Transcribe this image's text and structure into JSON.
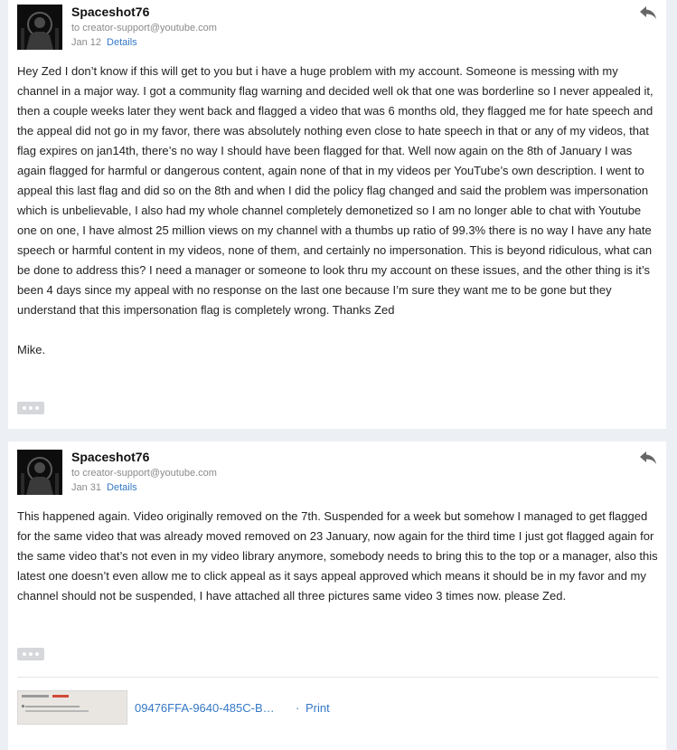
{
  "messages": [
    {
      "sender": "Spaceshot76",
      "to": "to creator-support@youtube.com",
      "date": "Jan 12",
      "details_label": "Details",
      "body": [
        "Hey Zed I don’t know if this will get to you but i have a huge problem with my account. Someone is messing with my channel in a major way.  I got a community flag warning and decided well ok that one was borderline so I never appealed it, then a couple weeks later they went back and flagged a video that was 6 months old, they flagged me for hate speech and the appeal did not go in my favor, there was absolutely nothing even close to hate speech in that or any of my videos, that flag expires on jan14th, there’s no way I should have been flagged for that. Well now again on the 8th of January I was again flagged for harmful or dangerous content, again none of that in my videos per YouTube’s own description.  I went to appeal this last flag and did so on the 8th and when I did the policy flag changed and said the problem was impersonation which is unbelievable, I also had my whole channel completely demonetized so I am no longer able to chat with Youtube one on one, I have almost 25 million views on my channel with a thumbs up ratio of 99.3% there is no way I have any hate speech or harmful content in my videos, none of them, and certainly no impersonation. This is beyond ridiculous, what can be done to address this? I need a manager or someone to look thru my account on these issues, and the other thing is it’s been 4 days since my appeal with no response on the last one because I’m sure they want me to be gone but they understand that this impersonation flag is completely wrong. Thanks Zed",
        "Mike."
      ]
    },
    {
      "sender": "Spaceshot76",
      "to": "to creator-support@youtube.com",
      "date": "Jan 31",
      "details_label": "Details",
      "body": [
        "This happened again. Video originally removed on the 7th. Suspended for a week but somehow I managed to get flagged for the same video that was already moved removed on 23 January, now again for the third time I just got flagged again for the same video that’s not even in my video library anymore, somebody needs to bring this to the top or a manager, also this latest one doesn’t even allow me to click appeal as it says appeal approved which means it should be in my favor and my channel should not be suspended, I have attached all three pictures same video 3 times now.  please Zed."
      ],
      "attachment": {
        "name": "09476FFA-9640-485C-B…",
        "separator": "·",
        "print_label": "Print"
      }
    }
  ],
  "icons": {
    "reply": "reply-arrow-icon",
    "more": "more-dots-icon",
    "avatar": "avatar-image"
  },
  "colors": {
    "background": "#eceff3",
    "link": "#3478c6",
    "muted": "#8a8a8a"
  }
}
